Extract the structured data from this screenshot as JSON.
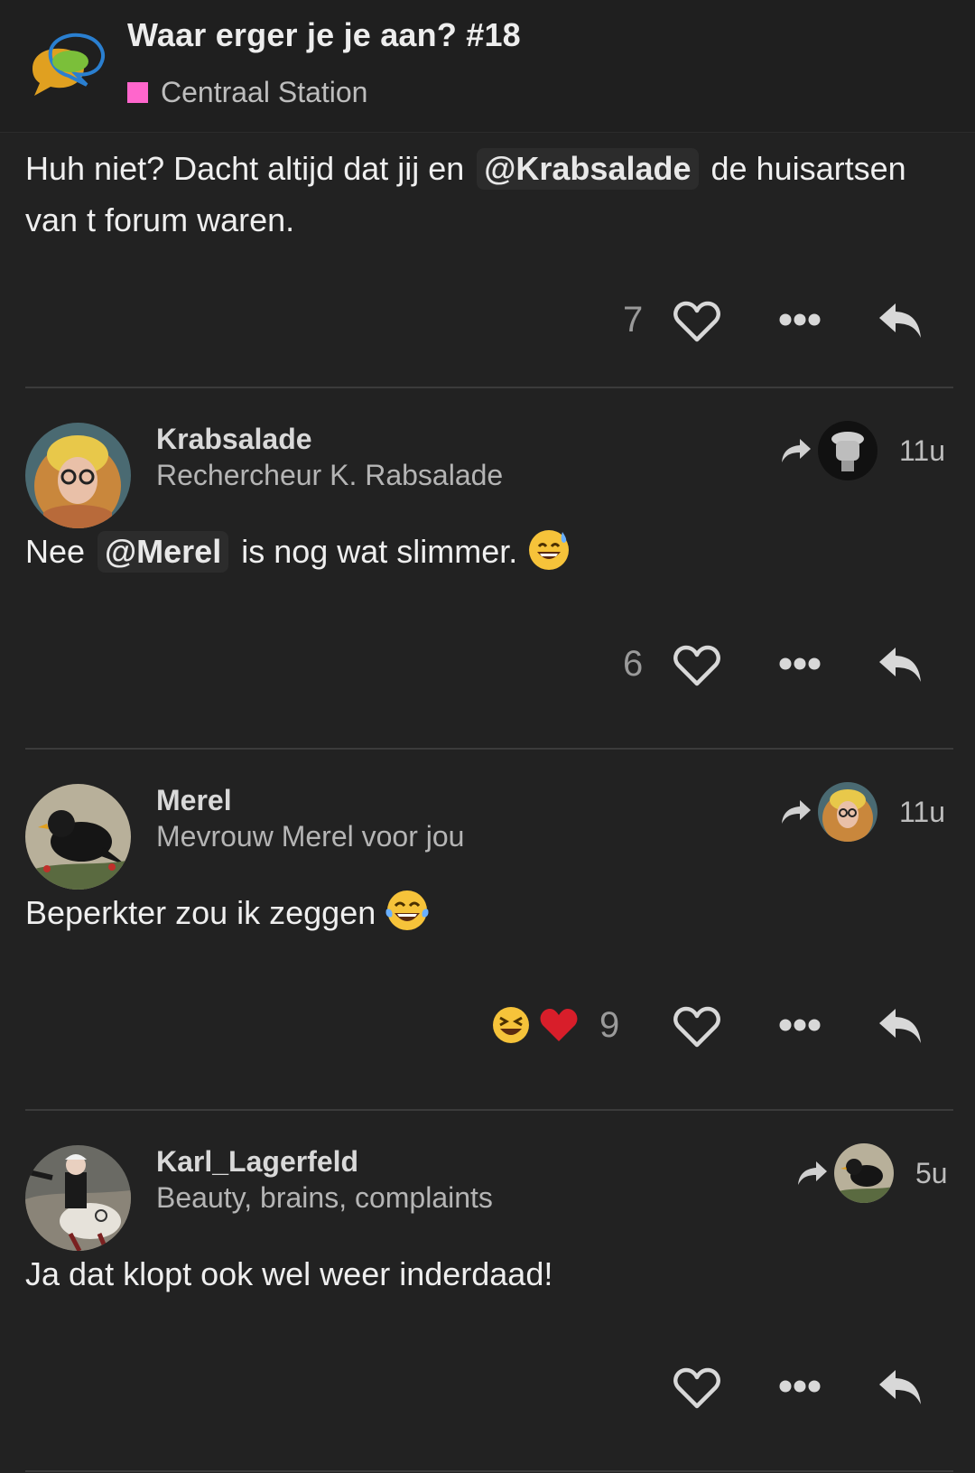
{
  "topic": {
    "title": "Waar erger je je aan? #18",
    "category": "Centraal Station",
    "category_color": "#ff66cc"
  },
  "posts": [
    {
      "body_parts": [
        "Huh niet? Dacht altijd dat jij en ",
        "@Krabsalade",
        " de huisartsen van t forum waren."
      ],
      "likes": "7"
    },
    {
      "username": "Krabsalade",
      "user_title": "Rechercheur K. Rabsalade",
      "age": "11u",
      "body_parts": [
        "Nee ",
        "@Merel",
        " is nog wat slimmer."
      ],
      "emoji": "sweat-smile-emoji",
      "likes": "6"
    },
    {
      "username": "Merel",
      "user_title": "Mevrouw Merel voor jou",
      "age": "11u",
      "body_parts": [
        "Beperkter zou ik zeggen"
      ],
      "emoji": "tears-of-joy-emoji",
      "reactions": [
        "laughing-emoji",
        "heart-emoji"
      ],
      "likes": "9"
    },
    {
      "username": "Karl_Lagerfeld",
      "user_title": "Beauty, brains, complaints",
      "age": "5u",
      "body_parts": [
        "Ja dat klopt ook wel weer inderdaad!"
      ]
    }
  ],
  "icons": {
    "like": "heart-outline-icon",
    "more": "more-dots-icon",
    "reply": "reply-icon",
    "in_reply_to": "share-arrow-icon"
  }
}
